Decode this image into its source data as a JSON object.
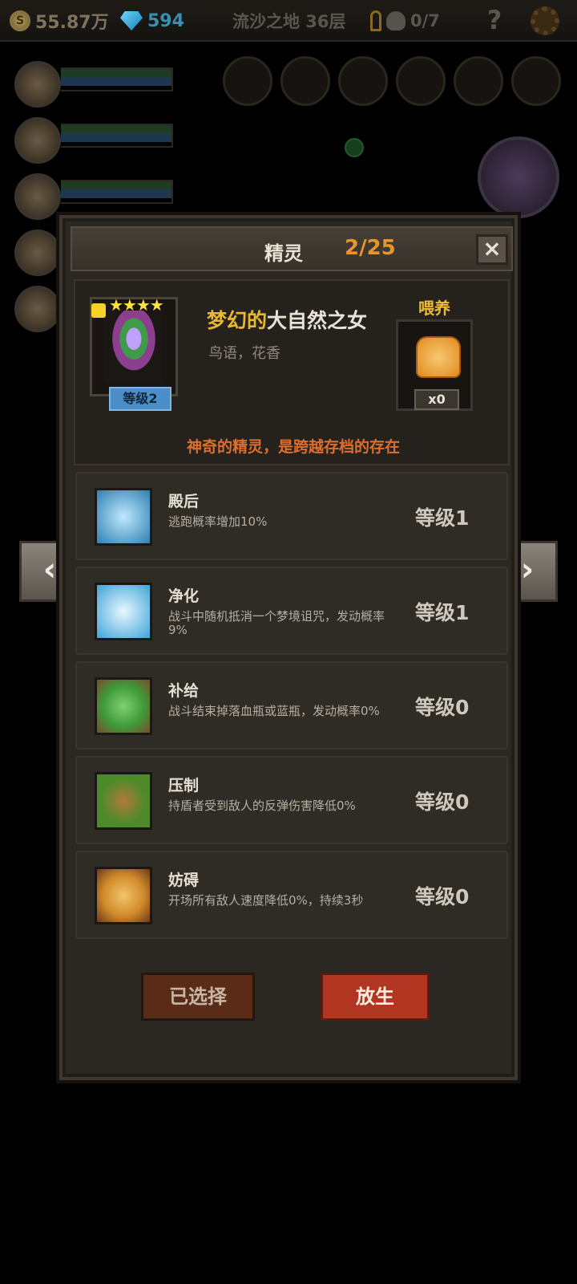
{
  "hud": {
    "gold": "55.87万",
    "gems": "594",
    "stage": "流沙之地 36层",
    "keys_deaths": "0/7",
    "help": "?"
  },
  "panel": {
    "title": "精灵",
    "count": "2/25",
    "close": "×"
  },
  "sprite": {
    "stars": "★★★★",
    "level": "等级2",
    "name_prefix": "梦幻的",
    "name_main": "大自然之女",
    "trait": "鸟语，花香",
    "feed_label": "喂养",
    "feed_count": "x0",
    "description": "神奇的精灵，是跨越存档的存在"
  },
  "skills": [
    {
      "name": "殿后",
      "desc": "逃跑概率增加10%",
      "level": "等级1",
      "icon": "wings-icon",
      "color": "#2f7fb0"
    },
    {
      "name": "净化",
      "desc": "战斗中随机抵消一个梦境诅咒，发动概率9%",
      "level": "等级1",
      "icon": "flower-icon",
      "color": "#3fa3d8"
    },
    {
      "name": "补给",
      "desc": "战斗结束掉落血瓶或蓝瓶，发动概率0%",
      "level": "等级0",
      "icon": "leaf-hand-icon",
      "color": "#3f9a3a"
    },
    {
      "name": "压制",
      "desc": "持盾者受到敌人的反弹伤害降低0%",
      "level": "等级0",
      "icon": "claw-icon",
      "color": "#4e8a2a"
    },
    {
      "name": "妨碍",
      "desc": "开场所有敌人速度降低0%，持续3秒",
      "level": "等级0",
      "icon": "chained-boot-icon",
      "color": "#d08a2a"
    }
  ],
  "buttons": {
    "selected": "已选择",
    "release": "放生",
    "prev": "‹",
    "next": "›"
  },
  "colors": {
    "accent_orange": "#e6962a",
    "name_gold": "#e8b833",
    "desc_orange": "#de6e2e",
    "release_red": "#b03621"
  }
}
